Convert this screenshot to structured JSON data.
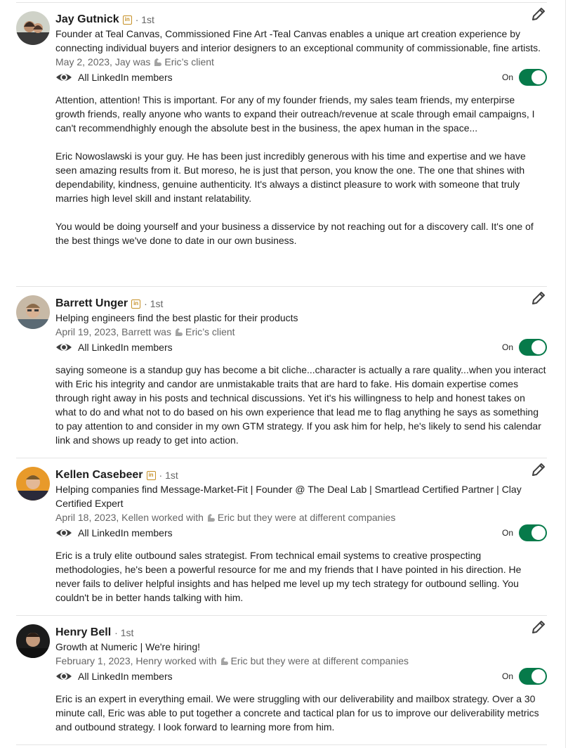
{
  "toggle_label": "On",
  "visibility_label": "All LinkedIn members",
  "colors": {
    "toggle_on": "#067a4a",
    "badge": "#c69026"
  },
  "recommendations": [
    {
      "name": "Jay Gutnick",
      "degree": "· 1st",
      "headline": "Founder at Teal Canvas, Commissioned Fine Art -Teal Canvas enables a unique art creation experience by connecting individual buyers and interior designers to an exceptional community of commissionable, fine artists.",
      "meta_prefix": "May 2, 2023, Jay was",
      "meta_suffix": "Eric’s client",
      "paragraphs": [
        "Attention, attention! This is important. For any of my founder friends, my sales team friends, my enterpirse growth friends, really anyone who wants to expand their outreach/revenue at scale through email campaigns, I can't recommendhighly enough the absolute best in the business, the apex human in the space...",
        "Eric Nowoslawski is your guy. He has been just incredibly generous with his time and expertise and we have seen amazing results from it. But moreso, he is just that person, you know the one. The one that shines with dependability, kindness, genuine authenticity. It's always a distinct pleasure to work with someone that truly marries high level skill and instant relatability.",
        "You would be doing yourself and your business a disservice by not reaching out for a discovery call. It's one of the best things we've done to date in our own business."
      ]
    },
    {
      "name": "Barrett Unger",
      "degree": "· 1st",
      "headline": "Helping engineers find the best plastic for their products",
      "meta_prefix": "April 19, 2023, Barrett was",
      "meta_suffix": "Eric’s client",
      "paragraphs": [
        "saying someone is a standup guy has become a bit cliche...character is actually a rare quality...when you interact with Eric his integrity and candor are unmistakable traits that are hard to fake. His domain expertise comes through right away in his posts and technical discussions. Yet it's his willingness to help and honest takes on what to do and what not to do based on his own experience that lead me to flag anything he says as something to pay attention to and consider in my own GTM strategy. If you ask him for help, he's likely to send his calendar link and shows up ready to get into action."
      ]
    },
    {
      "name": "Kellen Casebeer",
      "degree": "· 1st",
      "headline": "Helping companies find Message-Market-Fit | Founder @ The Deal Lab | Smartlead Certified Partner | Clay Certified Expert",
      "meta_prefix": "April 18, 2023, Kellen worked with",
      "meta_suffix": "Eric but they were at different companies",
      "paragraphs": [
        "Eric is a truly elite outbound sales strategist. From technical email systems to creative prospecting methodologies, he's been a powerful resource for me and my friends that I have pointed in his direction. He never fails to deliver helpful insights and has helped me level up my tech strategy for outbound selling. You couldn't be in better hands talking with him."
      ]
    },
    {
      "name": "Henry Bell",
      "degree": "· 1st",
      "headline": "Growth at Numeric | We're hiring!",
      "meta_prefix": "February 1, 2023, Henry worked with",
      "meta_suffix": "Eric but they were at different companies",
      "paragraphs": [
        "Eric is an expert in everything email. We were struggling with our deliverability and mailbox strategy. Over a 30 minute call, Eric was able to put together a concrete and tactical plan for us to improve our deliverability metrics and outbound strategy. I look forward to learning more from him."
      ]
    }
  ]
}
